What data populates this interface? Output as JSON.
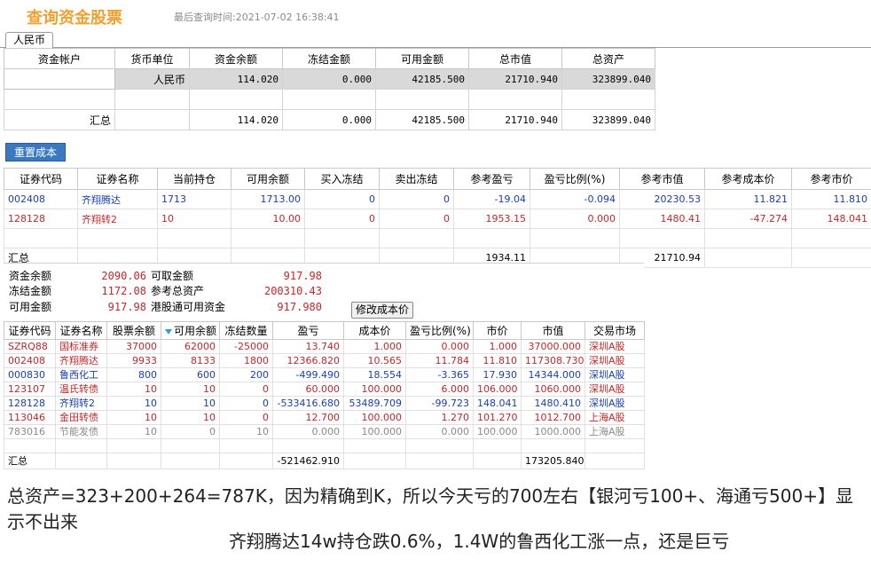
{
  "header": {
    "title": "查询资金股票",
    "last_query": "最后查询时间:2021-07-02 16:38:41"
  },
  "tabs": [
    {
      "label": "人民币"
    }
  ],
  "funds": {
    "columns": [
      "资金帐户",
      "货币单位",
      "资金余额",
      "冻结金额",
      "可用金额",
      "总市值",
      "总资产"
    ],
    "row": {
      "account": "",
      "currency": "人民币",
      "balance": "114.020",
      "frozen": "0.000",
      "available": "42185.500",
      "market_value": "21710.940",
      "total_assets": "323899.040"
    },
    "summary": {
      "label": "汇总",
      "balance": "114.020",
      "frozen": "0.000",
      "available": "42185.500",
      "market_value": "21710.940",
      "total_assets": "323899.040"
    }
  },
  "reset_cost_button": "重置成本",
  "positions": {
    "columns": [
      "证券代码",
      "证券名称",
      "当前持仓",
      "可用余额",
      "买入冻结",
      "卖出冻结",
      "参考盈亏",
      "盈亏比例(%)",
      "参考市值",
      "参考成本价",
      "参考市价"
    ],
    "rows": [
      {
        "code": "002408",
        "name": "齐翔腾达",
        "holding": "1713",
        "available": "1713.00",
        "buy_frozen": "0",
        "sell_frozen": "0",
        "pnl": "-19.04",
        "pnl_pct": "-0.094",
        "market_value": "20230.53",
        "cost_price": "11.821",
        "market_price": "11.810",
        "color": "blue"
      },
      {
        "code": "128128",
        "name": "齐翔转2",
        "holding": "10",
        "available": "10.00",
        "buy_frozen": "0",
        "sell_frozen": "0",
        "pnl": "1953.15",
        "pnl_pct": "0.000",
        "market_value": "1480.41",
        "cost_price": "-47.274",
        "market_price": "148.041",
        "color": "red"
      }
    ],
    "summary": {
      "label": "汇总",
      "pnl": "1934.11",
      "market_value": "21710.94"
    }
  },
  "account_panel": {
    "fund_balance_label": "资金余额",
    "fund_balance": "2090.06",
    "withdrawable_label": "可取金额",
    "withdrawable": "917.98",
    "frozen_label": "冻结金额",
    "frozen": "1172.08",
    "ref_total_label": "参考总资产",
    "ref_total": "200310.43",
    "available_label": "可用金额",
    "available": "917.98",
    "hk_connect_label": "港股通可用资金",
    "hk_connect": "917.980",
    "edit_cost_button": "修改成本价"
  },
  "holdings": {
    "columns": [
      "证券代码",
      "证券名称",
      "股票余额",
      "可用余额",
      "冻结数量",
      "盈亏",
      "成本价",
      "盈亏比例(%)",
      "市价",
      "市值",
      "交易市场"
    ],
    "rows": [
      {
        "code": "SZRQ88",
        "name": "国标准券",
        "shares": "37000",
        "available": "62000",
        "frozen": "-25000",
        "pnl": "13.740",
        "cost": "1.000",
        "pct": "0.000",
        "price": "1.000",
        "value": "37000.000",
        "market": "深圳A股",
        "color": "red"
      },
      {
        "code": "002408",
        "name": "齐翔腾达",
        "shares": "9933",
        "available": "8133",
        "frozen": "1800",
        "pnl": "12366.820",
        "cost": "10.565",
        "pct": "11.784",
        "price": "11.810",
        "value": "117308.730",
        "market": "深圳A股",
        "color": "red"
      },
      {
        "code": "000830",
        "name": "鲁西化工",
        "shares": "800",
        "available": "600",
        "frozen": "200",
        "pnl": "-499.490",
        "cost": "18.554",
        "pct": "-3.365",
        "price": "17.930",
        "value": "14344.000",
        "market": "深圳A股",
        "color": "blue"
      },
      {
        "code": "123107",
        "name": "温氏转债",
        "shares": "10",
        "available": "10",
        "frozen": "0",
        "pnl": "60.000",
        "cost": "100.000",
        "pct": "6.000",
        "price": "106.000",
        "value": "1060.000",
        "market": "深圳A股",
        "color": "red"
      },
      {
        "code": "128128",
        "name": "齐翔转2",
        "shares": "10",
        "available": "10",
        "frozen": "0",
        "pnl": "-533416.680",
        "cost": "53489.709",
        "pct": "-99.723",
        "price": "148.041",
        "value": "1480.410",
        "market": "深圳A股",
        "color": "blue"
      },
      {
        "code": "113046",
        "name": "金田转债",
        "shares": "10",
        "available": "10",
        "frozen": "0",
        "pnl": "12.700",
        "cost": "100.000",
        "pct": "1.270",
        "price": "101.270",
        "value": "1012.700",
        "market": "上海A股",
        "color": "red"
      },
      {
        "code": "783016",
        "name": "节能发债",
        "shares": "10",
        "available": "0",
        "frozen": "10",
        "pnl": "0.000",
        "cost": "100.000",
        "pct": "0.000",
        "price": "100.000",
        "value": "1000.000",
        "market": "上海A股",
        "color": "gray"
      }
    ],
    "summary": {
      "label": "汇总",
      "pnl": "-521462.910",
      "value": "173205.840"
    },
    "sort_icon": "sort-desc-icon",
    "colors": {
      "red": "#c0282a",
      "blue": "#1a3fb0",
      "gray": "#8a8a8a"
    }
  },
  "notes": {
    "line1": "总资产=323+200+264=787K，因为精确到K，所以今天亏的700左右【银河亏100+、海通亏500+】显示不出来",
    "line2": "齐翔腾达14w持仓跌0.6%，1.4W的鲁西化工涨一点，还是巨亏"
  }
}
